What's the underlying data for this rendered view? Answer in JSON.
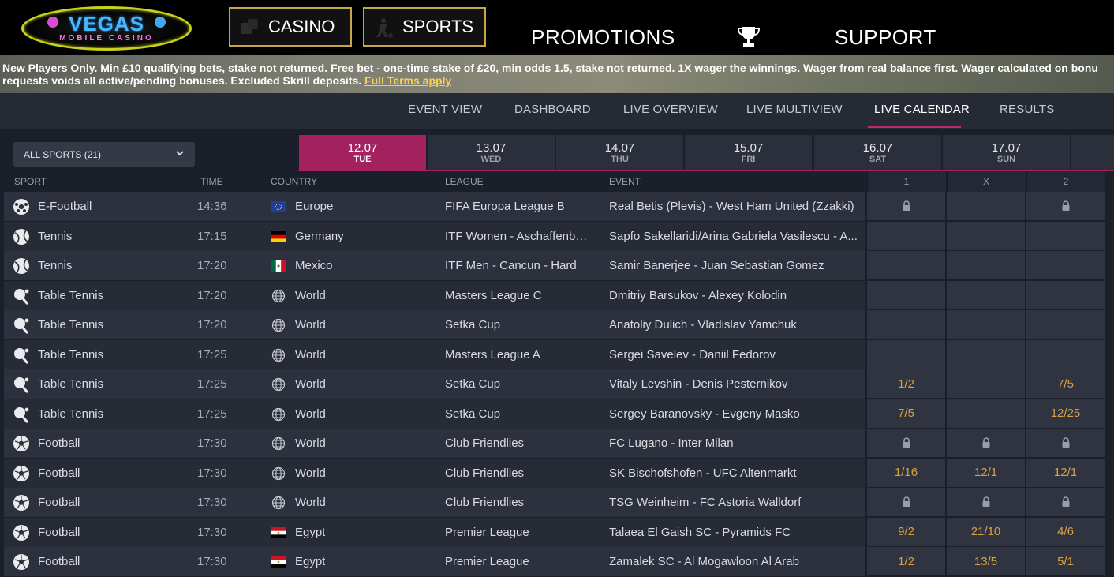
{
  "brand": {
    "logo_main": "VEGAS",
    "logo_sub": "MOBILE CASINO"
  },
  "topnav": {
    "casino": "CASINO",
    "sports": "SPORTS",
    "promotions": "PROMOTIONS",
    "support": "SUPPORT"
  },
  "terms": {
    "line1": "New Players Only. Min £10 qualifying bets, stake not returned. Free bet - one-time stake of £20, min odds 1.5, stake not returned. 1X wager the winnings. Wager from real balance first. Wager calculated on bonu",
    "line2": "requests voids all active/pending bonuses. Excluded Skrill deposits.",
    "link": "Full Terms apply"
  },
  "subnav": {
    "items": [
      "EVENT VIEW",
      "DASHBOARD",
      "LIVE OVERVIEW",
      "LIVE MULTIVIEW",
      "LIVE CALENDAR",
      "RESULTS"
    ],
    "active": "LIVE CALENDAR"
  },
  "filter": {
    "sports_select": "ALL SPORTS (21)"
  },
  "dates": [
    {
      "date": "12.07",
      "day": "TUE",
      "active": true
    },
    {
      "date": "13.07",
      "day": "WED",
      "active": false
    },
    {
      "date": "14.07",
      "day": "THU",
      "active": false
    },
    {
      "date": "15.07",
      "day": "FRI",
      "active": false
    },
    {
      "date": "16.07",
      "day": "SAT",
      "active": false
    },
    {
      "date": "17.07",
      "day": "SUN",
      "active": false
    }
  ],
  "table": {
    "headers": {
      "sport": "SPORT",
      "time": "TIME",
      "country": "COUNTRY",
      "league": "LEAGUE",
      "event": "EVENT",
      "o1": "1",
      "ox": "X",
      "o2": "2"
    },
    "rows": [
      {
        "sport": "E-Football",
        "icon": "efootball-icon",
        "time": "14:36",
        "flag": "eu",
        "country": "Europe",
        "league": "FIFA Europa League B",
        "event": "Real Betis (Plevis) - West Ham United (Zzakki)",
        "o1": "lock",
        "ox": "",
        "o2": "lock"
      },
      {
        "sport": "Tennis",
        "icon": "tennis-icon",
        "time": "17:15",
        "flag": "de",
        "country": "Germany",
        "league": "ITF Women - Aschaffenbu...",
        "event": "Sapfo Sakellaridi/Arina Gabriela Vasilescu - A...",
        "o1": "",
        "ox": "",
        "o2": ""
      },
      {
        "sport": "Tennis",
        "icon": "tennis-icon",
        "time": "17:20",
        "flag": "mx",
        "country": "Mexico",
        "league": "ITF Men - Cancun - Hard",
        "event": "Samir Banerjee - Juan Sebastian Gomez",
        "o1": "",
        "ox": "",
        "o2": ""
      },
      {
        "sport": "Table Tennis",
        "icon": "table-tennis-icon",
        "time": "17:20",
        "flag": "world",
        "country": "World",
        "league": "Masters League C",
        "event": "Dmitriy Barsukov - Alexey Kolodin",
        "o1": "",
        "ox": "",
        "o2": ""
      },
      {
        "sport": "Table Tennis",
        "icon": "table-tennis-icon",
        "time": "17:20",
        "flag": "world",
        "country": "World",
        "league": "Setka Cup",
        "event": "Anatoliy Dulich - Vladislav Yamchuk",
        "o1": "",
        "ox": "",
        "o2": ""
      },
      {
        "sport": "Table Tennis",
        "icon": "table-tennis-icon",
        "time": "17:25",
        "flag": "world",
        "country": "World",
        "league": "Masters League A",
        "event": "Sergei Savelev - Daniil Fedorov",
        "o1": "",
        "ox": "",
        "o2": ""
      },
      {
        "sport": "Table Tennis",
        "icon": "table-tennis-icon",
        "time": "17:25",
        "flag": "world",
        "country": "World",
        "league": "Setka Cup",
        "event": "Vitaly Levshin - Denis Pesternikov",
        "o1": "1/2",
        "ox": "",
        "o2": "7/5"
      },
      {
        "sport": "Table Tennis",
        "icon": "table-tennis-icon",
        "time": "17:25",
        "flag": "world",
        "country": "World",
        "league": "Setka Cup",
        "event": "Sergey Baranovsky - Evgeny Masko",
        "o1": "7/5",
        "ox": "",
        "o2": "12/25"
      },
      {
        "sport": "Football",
        "icon": "football-icon",
        "time": "17:30",
        "flag": "world",
        "country": "World",
        "league": "Club Friendlies",
        "event": "FC Lugano - Inter Milan",
        "o1": "lock",
        "ox": "lock",
        "o2": "lock"
      },
      {
        "sport": "Football",
        "icon": "football-icon",
        "time": "17:30",
        "flag": "world",
        "country": "World",
        "league": "Club Friendlies",
        "event": "SK Bischofshofen - UFC Altenmarkt",
        "o1": "1/16",
        "ox": "12/1",
        "o2": "12/1"
      },
      {
        "sport": "Football",
        "icon": "football-icon",
        "time": "17:30",
        "flag": "world",
        "country": "World",
        "league": "Club Friendlies",
        "event": "TSG Weinheim - FC Astoria Walldorf",
        "o1": "lock",
        "ox": "lock",
        "o2": "lock"
      },
      {
        "sport": "Football",
        "icon": "football-icon",
        "time": "17:30",
        "flag": "eg",
        "country": "Egypt",
        "league": "Premier League",
        "event": "Talaea El Gaish SC - Pyramids FC",
        "o1": "9/2",
        "ox": "21/10",
        "o2": "4/6"
      },
      {
        "sport": "Football",
        "icon": "football-icon",
        "time": "17:30",
        "flag": "eg",
        "country": "Egypt",
        "league": "Premier League",
        "event": "Zamalek SC - Al Mogawloon Al Arab",
        "o1": "1/2",
        "ox": "13/5",
        "o2": "5/1"
      }
    ]
  }
}
